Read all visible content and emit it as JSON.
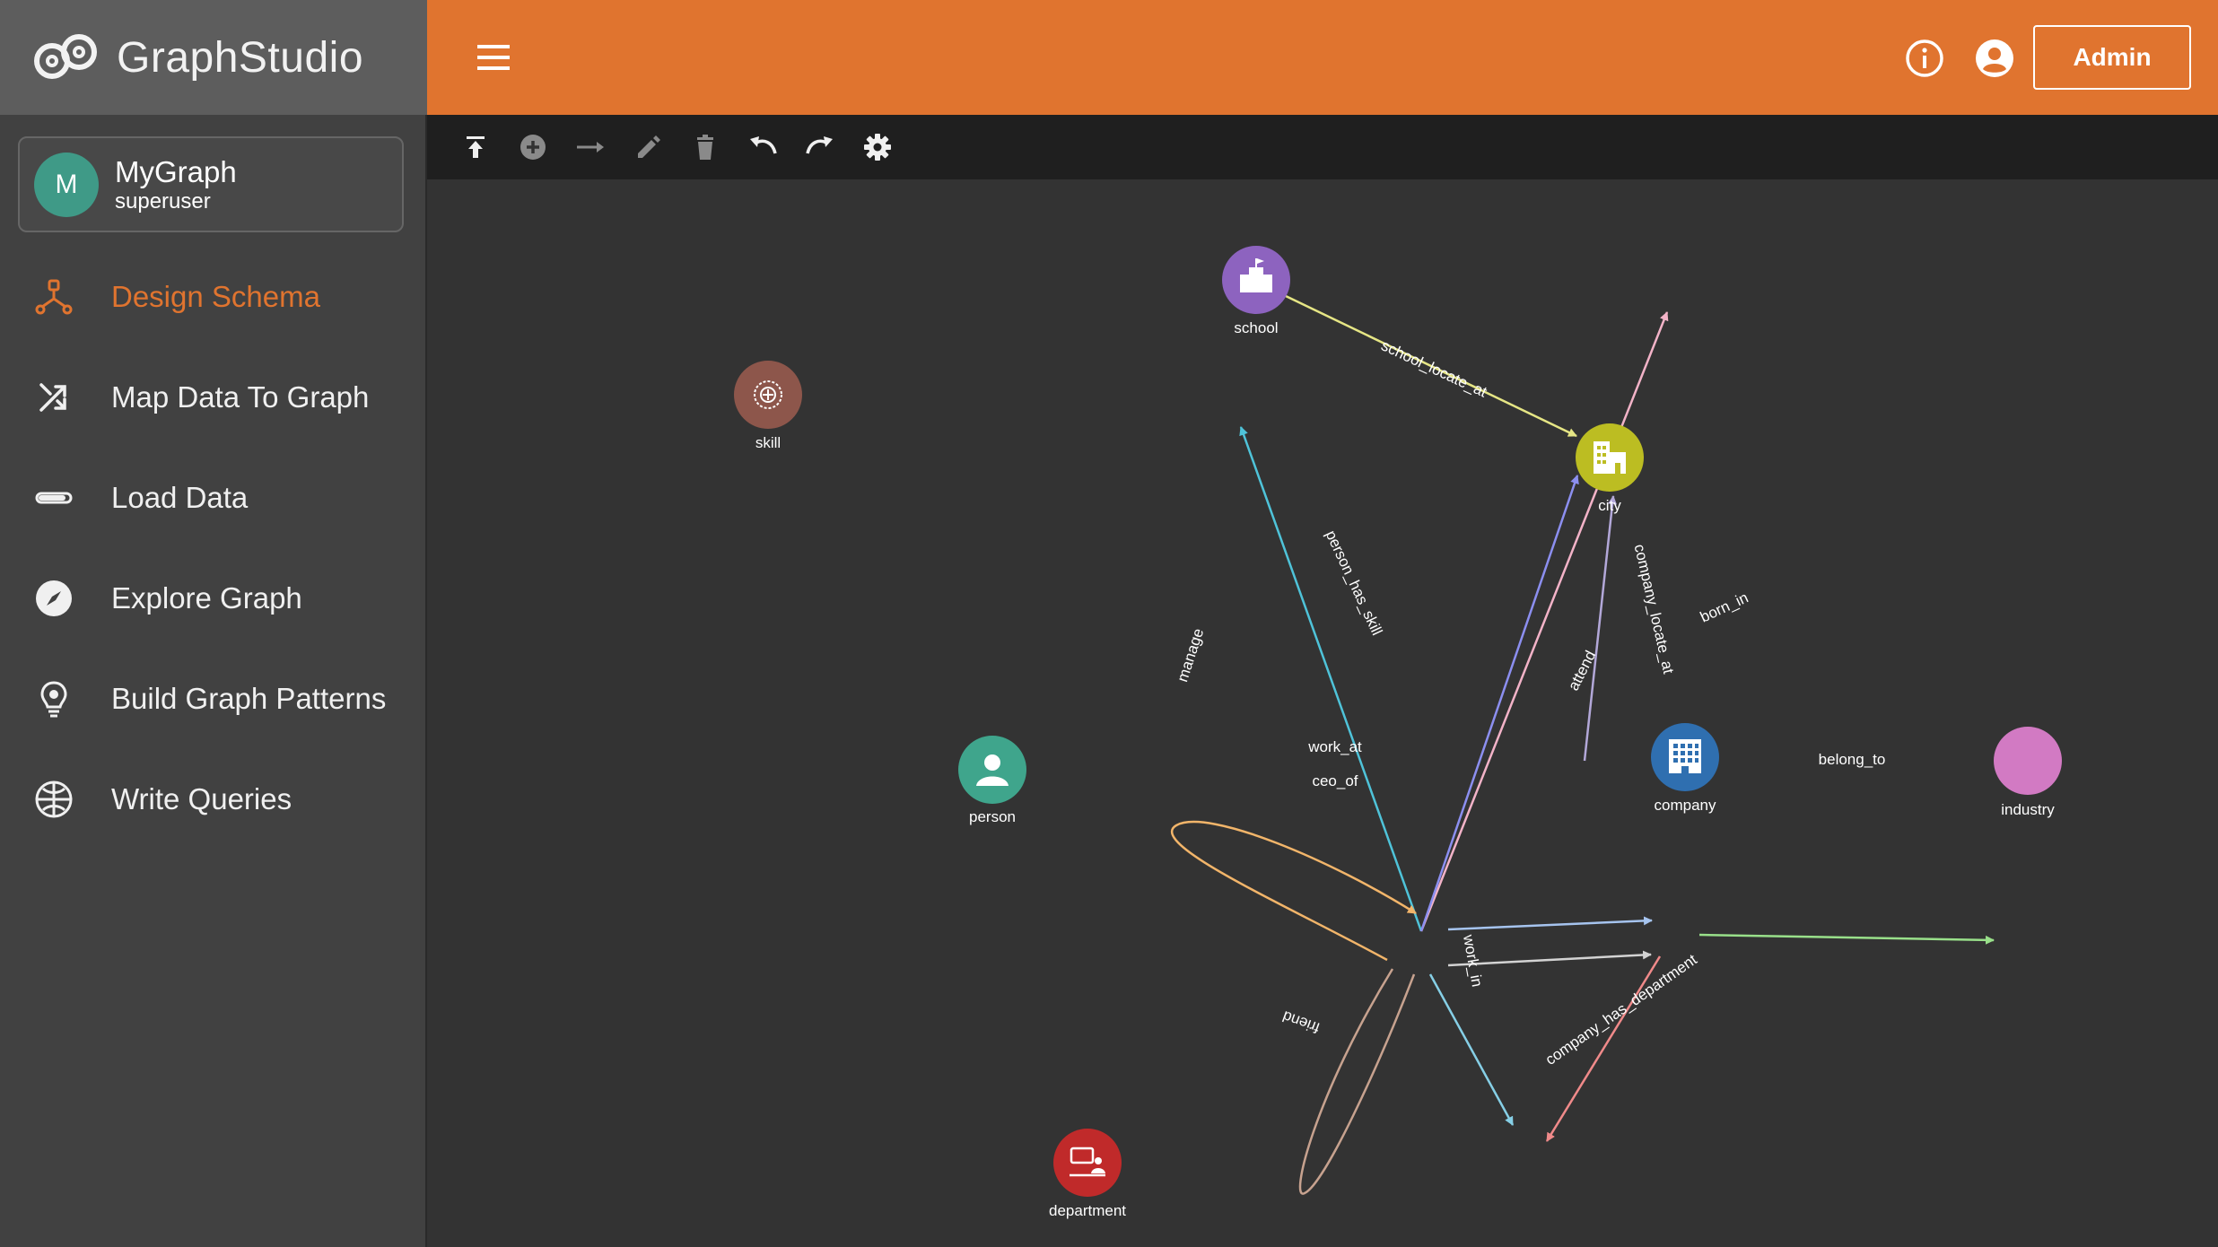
{
  "app": {
    "logo_text": "GraphStudio",
    "admin_label": "Admin"
  },
  "graph": {
    "avatar_letter": "M",
    "name": "MyGraph",
    "role": "superuser"
  },
  "nav": {
    "items": [
      {
        "label": "Design Schema",
        "icon": "schema-icon",
        "active": true
      },
      {
        "label": "Map Data To Graph",
        "icon": "shuffle-icon",
        "active": false
      },
      {
        "label": "Load Data",
        "icon": "progress-bar-icon",
        "active": false
      },
      {
        "label": "Explore Graph",
        "icon": "compass-icon",
        "active": false
      },
      {
        "label": "Build Graph Patterns",
        "icon": "lightbulb-icon",
        "active": false
      },
      {
        "label": "Write Queries",
        "icon": "query-globe-icon",
        "active": false
      }
    ]
  },
  "toolbar": {
    "tools": [
      "publish-icon",
      "add-vertex-icon",
      "add-edge-icon",
      "edit-icon",
      "delete-icon",
      "undo-icon",
      "redo-icon",
      "settings-icon"
    ]
  },
  "colors": {
    "accent": "#e0742f",
    "sidebar": "#414141",
    "canvas": "#333333"
  },
  "schema": {
    "vertices": [
      {
        "id": "school",
        "label": "school",
        "color": "#8d63bf"
      },
      {
        "id": "skill",
        "label": "skill",
        "color": "#8d564b"
      },
      {
        "id": "city",
        "label": "city",
        "color": "#bcbd22"
      },
      {
        "id": "person",
        "label": "person",
        "color": "#3fa58c"
      },
      {
        "id": "company",
        "label": "company",
        "color": "#2f6fb0"
      },
      {
        "id": "industry",
        "label": "industry",
        "color": "#d27ac3"
      },
      {
        "id": "department",
        "label": "department",
        "color": "#c02a2a"
      }
    ],
    "edges": [
      {
        "id": "school_locate_at",
        "label": "school_locate_at",
        "color": "#e6e685"
      },
      {
        "id": "person_has_skill",
        "label": "person_has_skill",
        "color": "#4fc3d9"
      },
      {
        "id": "attend",
        "label": "attend",
        "color": "#f3b3c8"
      },
      {
        "id": "born_in",
        "label": "born_in",
        "color": "#8c8ff0"
      },
      {
        "id": "company_locate_at",
        "label": "company_locate_at",
        "color": "#b3a8d9"
      },
      {
        "id": "manage",
        "label": "manage",
        "color": "#f2b56a"
      },
      {
        "id": "work_at",
        "label": "work_at",
        "color": "#a6c4ef"
      },
      {
        "id": "ceo_of",
        "label": "ceo_of",
        "color": "#d3d3d3"
      },
      {
        "id": "belong_to",
        "label": "belong_to",
        "color": "#99e08a"
      },
      {
        "id": "work_in",
        "label": "work_in",
        "color": "#86cfe6"
      },
      {
        "id": "company_has_department",
        "label": "company_has_department",
        "color": "#f08a8a"
      },
      {
        "id": "friend",
        "label": "friend",
        "color": "#c7a28f"
      }
    ]
  }
}
